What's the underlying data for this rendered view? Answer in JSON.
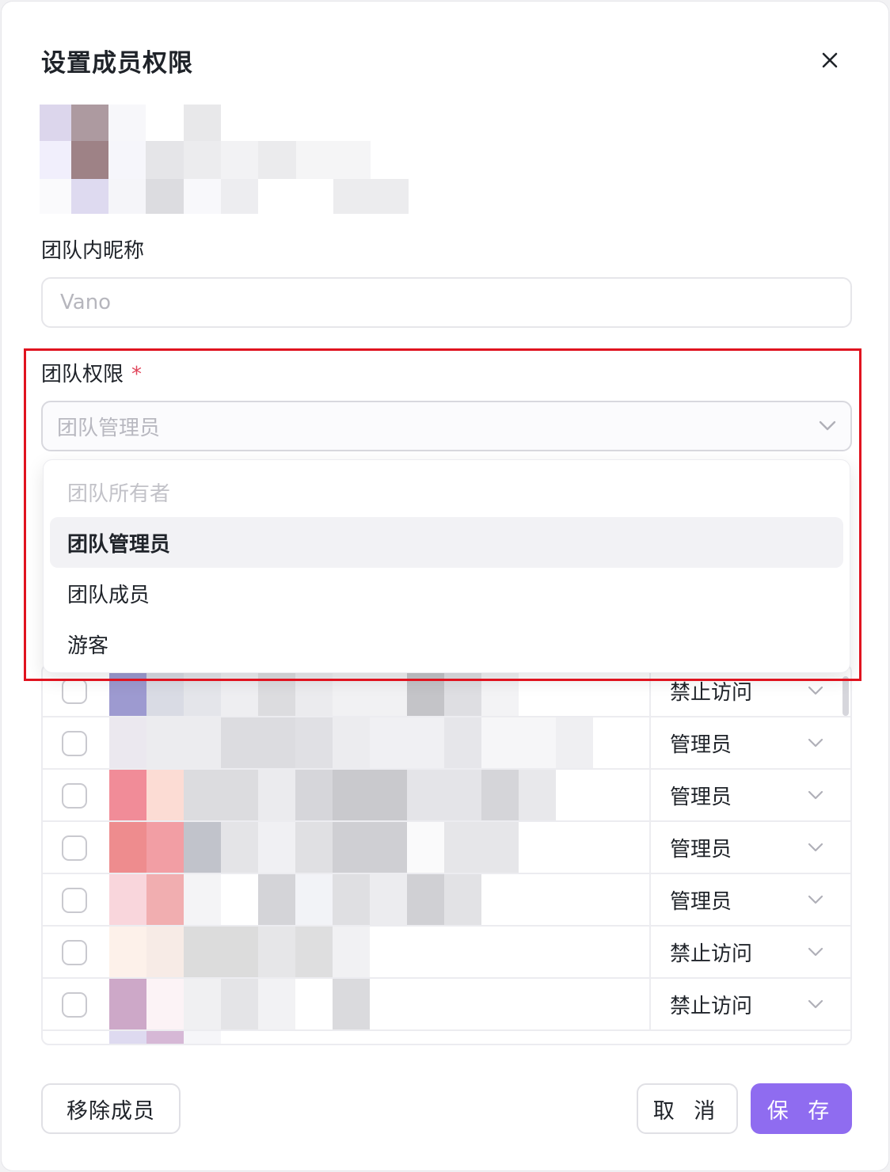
{
  "dialog": {
    "title": "设置成员权限",
    "close_icon": "close-icon"
  },
  "nickname": {
    "label": "团队内昵称",
    "placeholder": "Vano"
  },
  "permission": {
    "label": "团队权限",
    "required_mark": "*",
    "selected": "团队管理员",
    "chevron_icon": "chevron-down-icon",
    "options": [
      {
        "label": "团队所有者",
        "state": "disabled"
      },
      {
        "label": "团队管理员",
        "state": "selected"
      },
      {
        "label": "团队成员",
        "state": "normal"
      },
      {
        "label": "游客",
        "state": "normal"
      }
    ]
  },
  "members": {
    "rows": [
      {
        "role": "禁止访问"
      },
      {
        "role": "管理员"
      },
      {
        "role": "管理员"
      },
      {
        "role": "管理员"
      },
      {
        "role": "管理员"
      },
      {
        "role": "禁止访问"
      },
      {
        "role": "禁止访问"
      }
    ]
  },
  "footer": {
    "remove_label": "移除成员",
    "cancel_label": "取 消",
    "save_label": "保 存"
  },
  "colors": {
    "primary": "#8f6cf0",
    "highlight_border": "#e0131f",
    "required": "#e0455a"
  }
}
